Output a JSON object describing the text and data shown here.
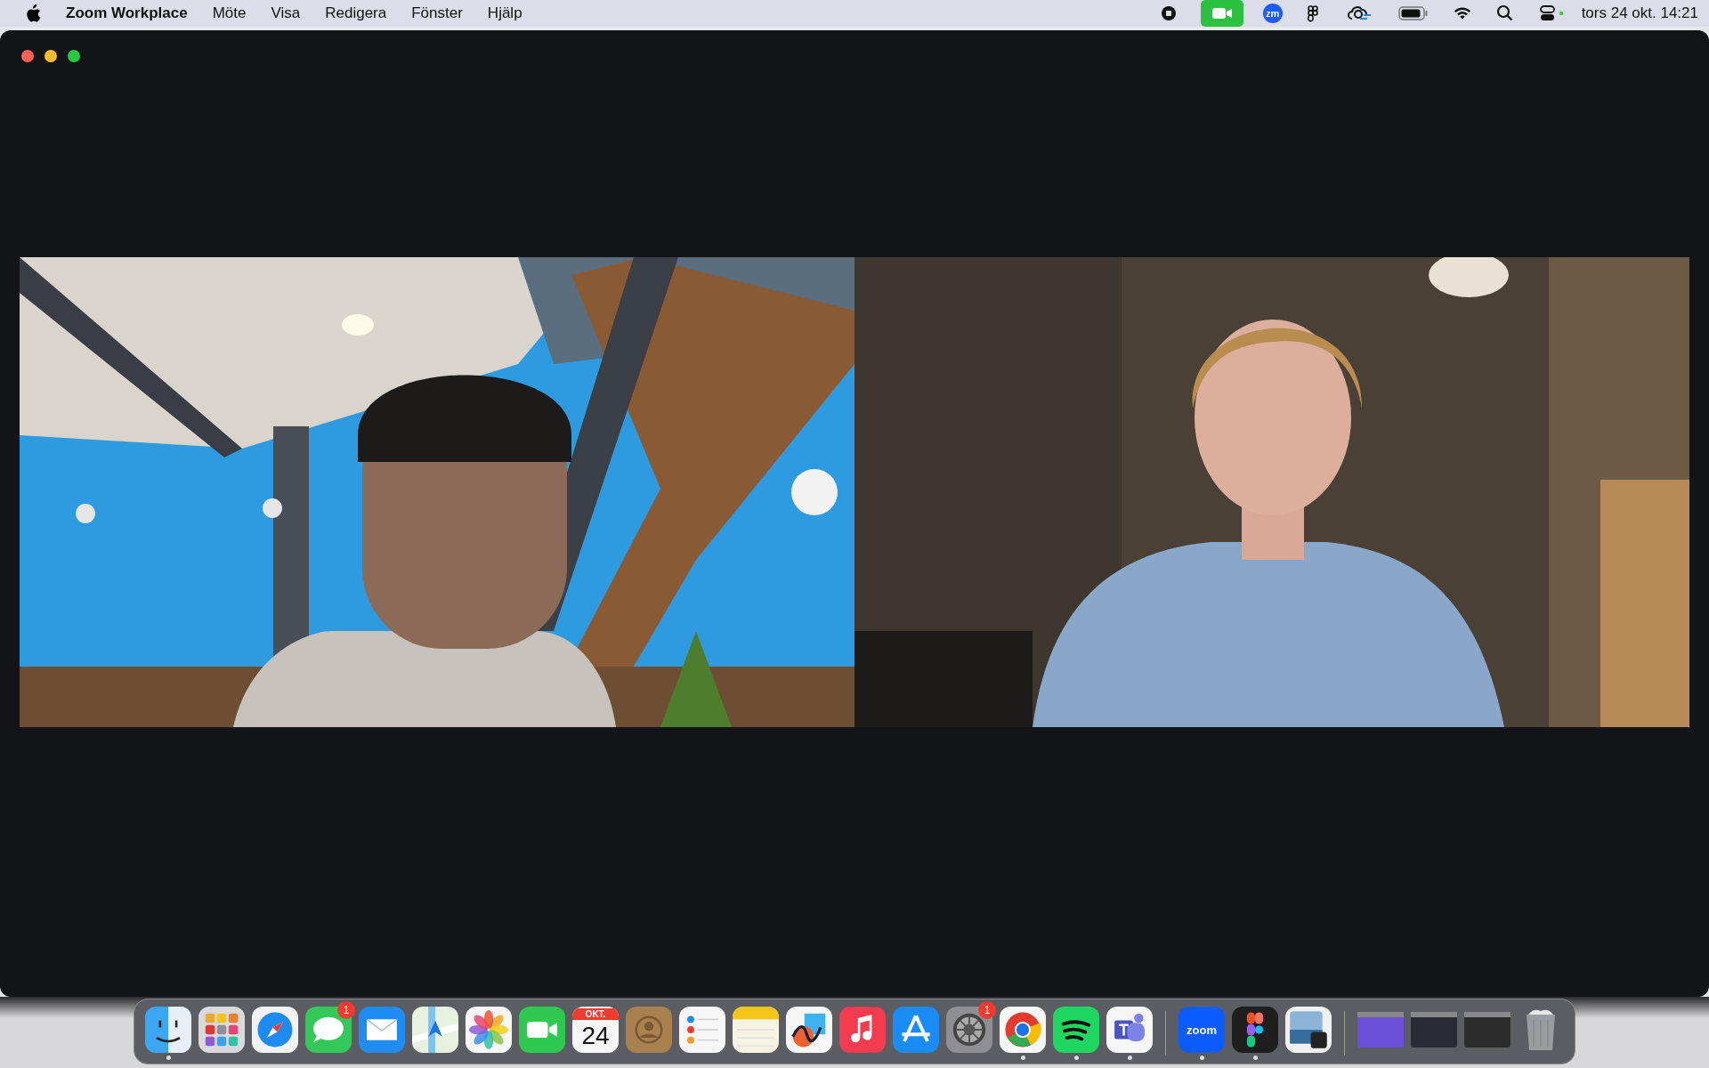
{
  "menu_bar": {
    "app_name": "Zoom Workplace",
    "menus": [
      "Möte",
      "Visa",
      "Redigera",
      "Fönster",
      "Hjälp"
    ],
    "zoom_status": "zm",
    "clock": "tors 24 okt. 14:21"
  },
  "dock": {
    "apps": [
      {
        "kind": "finder",
        "running": true
      },
      {
        "kind": "launchpad",
        "running": false
      },
      {
        "kind": "safari",
        "running": false
      },
      {
        "kind": "messages",
        "running": false,
        "badge": "1"
      },
      {
        "kind": "mail",
        "running": false
      },
      {
        "kind": "maps",
        "running": false
      },
      {
        "kind": "photos",
        "running": false
      },
      {
        "kind": "facetime",
        "running": false
      },
      {
        "kind": "calendar",
        "running": false,
        "month": "OKT.",
        "day": "24"
      },
      {
        "kind": "contacts",
        "running": false
      },
      {
        "kind": "reminders",
        "running": false
      },
      {
        "kind": "notes",
        "running": false
      },
      {
        "kind": "freeform",
        "running": false
      },
      {
        "kind": "music",
        "running": false
      },
      {
        "kind": "appstore",
        "running": false
      },
      {
        "kind": "settings",
        "running": false,
        "badge": "1"
      },
      {
        "kind": "chrome",
        "running": true
      },
      {
        "kind": "spotify",
        "running": true
      },
      {
        "kind": "teams",
        "running": true
      }
    ],
    "pinned": [
      {
        "kind": "zoom",
        "running": true,
        "label": "zoom"
      },
      {
        "kind": "figma",
        "running": true
      },
      {
        "kind": "preview",
        "running": false
      }
    ],
    "windows": [
      {
        "kind": "purple"
      },
      {
        "kind": "teams"
      },
      {
        "kind": "figma"
      }
    ]
  }
}
